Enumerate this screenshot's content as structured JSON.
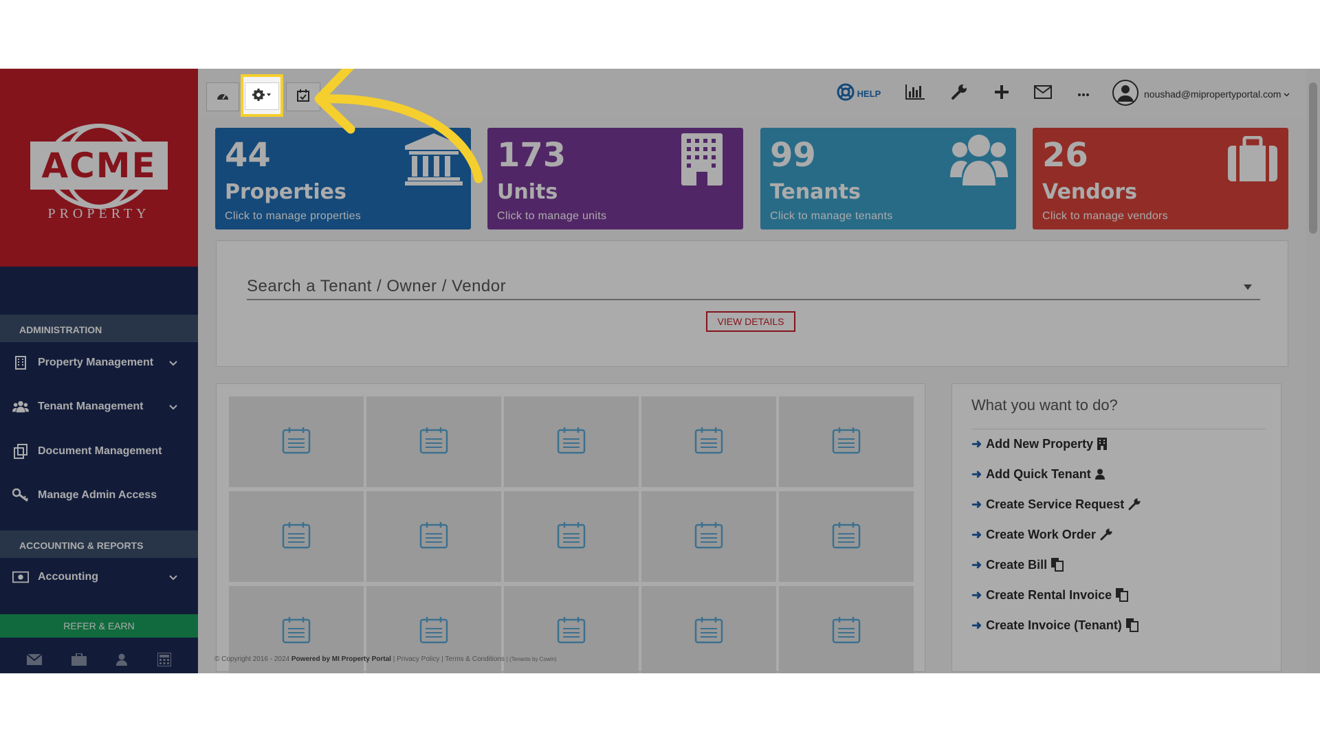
{
  "sidebar": {
    "logo": {
      "brand": "ACME",
      "sub": "PROPERTY"
    },
    "sections": [
      {
        "heading": "ADMINISTRATION"
      },
      {
        "heading": "ACCOUNTING & REPORTS"
      }
    ],
    "items": [
      {
        "label": "Property Management",
        "icon": "building-icon",
        "has_dropdown": true
      },
      {
        "label": "Tenant Management",
        "icon": "users-icon",
        "has_dropdown": true
      },
      {
        "label": "Document Management",
        "icon": "documents-icon",
        "has_dropdown": false
      },
      {
        "label": "Manage Admin Access",
        "icon": "key-icon",
        "has_dropdown": false
      },
      {
        "label": "Accounting",
        "icon": "money-icon",
        "has_dropdown": true
      }
    ],
    "refer_label": "REFER & EARN",
    "footer_icons": [
      "mail-icon",
      "briefcase-icon",
      "user-icon",
      "calculator-icon"
    ]
  },
  "topbar": {
    "left_buttons": [
      "dashboard-icon",
      "settings-icon",
      "calendar-icon"
    ],
    "help_label": "HELP",
    "right_icons": [
      "chart-icon",
      "wrench-icon",
      "plus-icon",
      "mail-icon",
      "more-icon"
    ],
    "user_email": "noushad@mipropertyportal.com"
  },
  "stats": [
    {
      "value": "44",
      "label": "Properties",
      "sub": "Click to manage properties",
      "color": "#1f6db5",
      "icon": "institution-icon"
    },
    {
      "value": "173",
      "label": "Units",
      "sub": "Click to manage units",
      "color": "#7a3a99",
      "icon": "building-icon"
    },
    {
      "value": "99",
      "label": "Tenants",
      "sub": "Click to manage tenants",
      "color": "#3ca0c9",
      "icon": "users-icon"
    },
    {
      "value": "26",
      "label": "Vendors",
      "sub": "Click to manage vendors",
      "color": "#d9433a",
      "icon": "briefcase-icon"
    }
  ],
  "search": {
    "placeholder": "Search a Tenant / Owner / Vendor",
    "button": "VIEW DETAILS"
  },
  "actions": {
    "title": "What you want to do?",
    "items": [
      {
        "label": "Add New Property",
        "icon": "building-icon"
      },
      {
        "label": "Add Quick Tenant",
        "icon": "user-icon"
      },
      {
        "label": "Create Service Request",
        "icon": "wrench-icon"
      },
      {
        "label": "Create Work Order",
        "icon": "wrench-icon"
      },
      {
        "label": "Create Bill",
        "icon": "copy-icon"
      },
      {
        "label": "Create Rental Invoice",
        "icon": "copy-icon"
      },
      {
        "label": "Create Invoice (Tenant)",
        "icon": "copy-icon"
      }
    ]
  },
  "footer": {
    "copyright": "© Copyright 2016 - 2024",
    "powered": "Powered by MI Property Portal",
    "links": "| Privacy Policy | Terms & Conditions",
    "note": "| (Tenants by Cowin)"
  },
  "colors": {
    "highlight": "#f5cf2d",
    "sidebar": "#1c2a55",
    "logo_bg": "#c41e2a",
    "refer": "#1a9e5c"
  }
}
